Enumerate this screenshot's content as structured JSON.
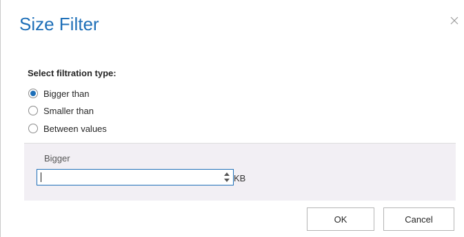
{
  "dialog": {
    "title": "Size Filter",
    "close_icon": "close-icon"
  },
  "filtration": {
    "label": "Select filtration type:",
    "options": [
      {
        "label": "Bigger than",
        "selected": true
      },
      {
        "label": "Smaller than",
        "selected": false
      },
      {
        "label": "Between values",
        "selected": false
      }
    ]
  },
  "value_panel": {
    "label": "Bigger",
    "input_value": "",
    "unit": "KB"
  },
  "buttons": {
    "ok": "OK",
    "cancel": "Cancel"
  },
  "colors": {
    "accent": "#1e6fb8",
    "panel_bg": "#f2eff4"
  }
}
